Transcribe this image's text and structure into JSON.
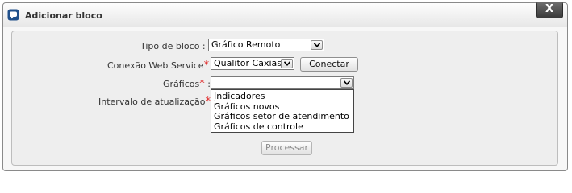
{
  "dialog": {
    "title": "Adicionar bloco",
    "close_label": "X"
  },
  "form": {
    "tipo_bloco": {
      "label": "Tipo de bloco :",
      "selected": "Gráfico Remoto"
    },
    "conexao": {
      "label": "Conexão Web Service",
      "required_mark": "*",
      "suffix": ":",
      "selected": "Qualitor Caxias",
      "connect_label": "Conectar"
    },
    "graficos": {
      "label": "Gráficos",
      "required_mark": "*",
      "suffix": ":",
      "selected": "",
      "options": [
        "Indicadores",
        "Gráficos novos",
        "Gráficos setor de atendimento",
        "Gráficos de controle"
      ]
    },
    "intervalo": {
      "label": "Intervalo de atualização",
      "required_mark": "*",
      "suffix": ":"
    },
    "submit_label": "Processar"
  }
}
